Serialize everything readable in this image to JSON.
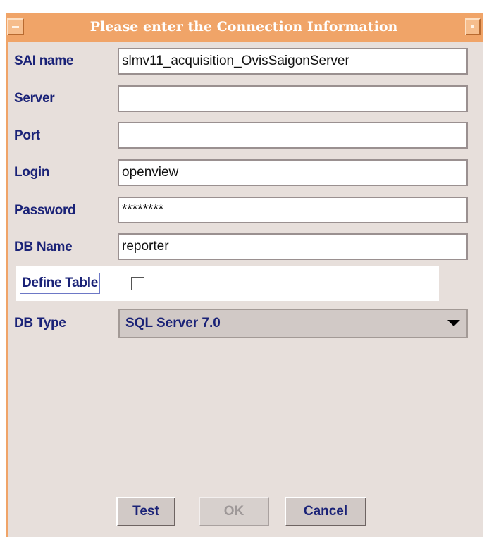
{
  "window": {
    "title": "Please enter the Connection Information"
  },
  "form": {
    "fields": [
      {
        "label": "SAI name",
        "value": "slmv11_acquisition_OvisSaigonServer"
      },
      {
        "label": "Server",
        "value": ""
      },
      {
        "label": "Port",
        "value": ""
      },
      {
        "label": "Login",
        "value": "openview"
      },
      {
        "label": "Password",
        "value": "********"
      },
      {
        "label": "DB Name",
        "value": "reporter"
      }
    ],
    "define_table": {
      "label": "Define Table",
      "checked": false
    },
    "db_type": {
      "label": "DB Type",
      "selected": "SQL Server 7.0"
    }
  },
  "buttons": {
    "test": "Test",
    "ok": "OK",
    "cancel": "Cancel"
  },
  "colors": {
    "title_bar": "#f0a468",
    "panel": "#e7dfdb",
    "label_text": "#1a2277"
  }
}
